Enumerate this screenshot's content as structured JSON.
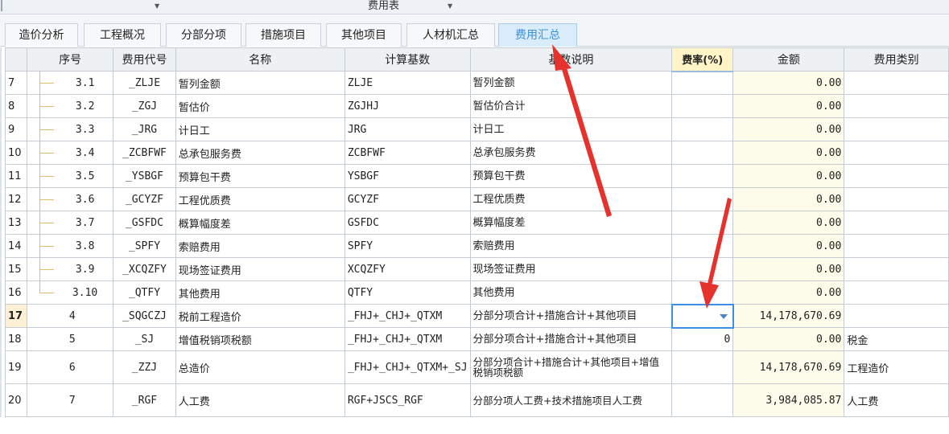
{
  "topbar": {
    "title": "费用表"
  },
  "tabs": [
    {
      "label": "造价分析"
    },
    {
      "label": "工程概况"
    },
    {
      "label": "分部分项"
    },
    {
      "label": "措施项目"
    },
    {
      "label": "其他项目"
    },
    {
      "label": "人材机汇总"
    },
    {
      "label": "费用汇总"
    }
  ],
  "active_tab": "费用汇总",
  "columns": {
    "seq": "序号",
    "code": "费用代号",
    "name": "名称",
    "base": "计算基数",
    "desc": "基数说明",
    "rate": "费率(%)",
    "amount": "金额",
    "category": "费用类别"
  },
  "rows": [
    {
      "rownum": "7",
      "seq": "3.1",
      "code": "_ZLJE",
      "name": "暂列金额",
      "base": "ZLJE",
      "desc": "暂列金额",
      "rate": "",
      "amount": "0.00",
      "category": ""
    },
    {
      "rownum": "8",
      "seq": "3.2",
      "code": "_ZGJ",
      "name": "暂估价",
      "base": "ZGJHJ",
      "desc": "暂估价合计",
      "rate": "",
      "amount": "0.00",
      "category": ""
    },
    {
      "rownum": "9",
      "seq": "3.3",
      "code": "_JRG",
      "name": "计日工",
      "base": "JRG",
      "desc": "计日工",
      "rate": "",
      "amount": "0.00",
      "category": ""
    },
    {
      "rownum": "10",
      "seq": "3.4",
      "code": "_ZCBFWF",
      "name": "总承包服务费",
      "base": "ZCBFWF",
      "desc": "总承包服务费",
      "rate": "",
      "amount": "0.00",
      "category": ""
    },
    {
      "rownum": "11",
      "seq": "3.5",
      "code": "_YSBGF",
      "name": "预算包干费",
      "base": "YSBGF",
      "desc": "预算包干费",
      "rate": "",
      "amount": "0.00",
      "category": ""
    },
    {
      "rownum": "12",
      "seq": "3.6",
      "code": "_GCYZF",
      "name": "工程优质费",
      "base": "GCYZF",
      "desc": "工程优质费",
      "rate": "",
      "amount": "0.00",
      "category": ""
    },
    {
      "rownum": "13",
      "seq": "3.7",
      "code": "_GSFDC",
      "name": "概算幅度差",
      "base": "GSFDC",
      "desc": "概算幅度差",
      "rate": "",
      "amount": "0.00",
      "category": ""
    },
    {
      "rownum": "14",
      "seq": "3.8",
      "code": "_SPFY",
      "name": "索赔费用",
      "base": "SPFY",
      "desc": "索赔费用",
      "rate": "",
      "amount": "0.00",
      "category": ""
    },
    {
      "rownum": "15",
      "seq": "3.9",
      "code": "_XCQZFY",
      "name": "现场签证费用",
      "base": "XCQZFY",
      "desc": "现场签证费用",
      "rate": "",
      "amount": "0.00",
      "category": ""
    },
    {
      "rownum": "16",
      "seq": "3.10",
      "code": "_QTFY",
      "name": "其他费用",
      "base": "QTFY",
      "desc": "其他费用",
      "rate": "",
      "amount": "0.00",
      "category": ""
    },
    {
      "rownum": "17",
      "seq": "4",
      "code": "_SQGCZJ",
      "name": "税前工程造价",
      "base": "_FHJ+_CHJ+_QTXM",
      "desc": "分部分项合计+措施合计+其他项目",
      "rate": "",
      "amount": "14,178,670.69",
      "category": ""
    },
    {
      "rownum": "18",
      "seq": "5",
      "code": "_SJ",
      "name": "增值税销项税额",
      "base": "_FHJ+_CHJ+_QTXM",
      "desc": "分部分项合计+措施合计+其他项目",
      "rate": "0",
      "amount": "0.00",
      "category": "税金"
    },
    {
      "rownum": "19",
      "seq": "6",
      "code": "_ZZJ",
      "name": "总造价",
      "base": "_FHJ+_CHJ+_QTXM+_SJ",
      "desc": "分部分项合计+措施合计+其他项目+增值税销项税额",
      "rate": "",
      "amount": "14,178,670.69",
      "category": "工程造价"
    },
    {
      "rownum": "20",
      "seq": "7",
      "code": "_RGF",
      "name": "人工费",
      "base": "RGF+JSCS_RGF",
      "desc": "分部分项人工费+技术措施项目人工费",
      "rate": "",
      "amount": "3,984,085.87",
      "category": "人工费"
    }
  ],
  "colors": {
    "active_tab_text": "#3d8fd6",
    "annotation_arrow": "#e5322d",
    "selection_border": "#3c8ee6"
  }
}
